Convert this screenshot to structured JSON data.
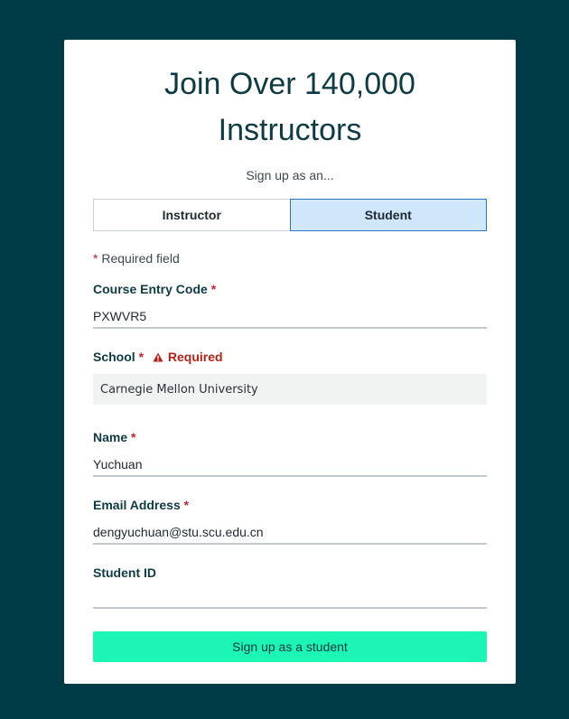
{
  "header": {
    "title_line1": "Join Over 140,000",
    "title_line2": "Instructors",
    "subtitle": "Sign up as an..."
  },
  "role_toggle": {
    "options": [
      "Instructor",
      "Student"
    ],
    "selected": "Student"
  },
  "required_note": {
    "star": "*",
    "text": "Required field"
  },
  "fields": {
    "course_entry_code": {
      "label": "Course Entry Code",
      "required_star": "*",
      "value": "PXWVR5"
    },
    "school": {
      "label": "School",
      "required_star": "*",
      "error": "Required",
      "value": "Carnegie Mellon University"
    },
    "name": {
      "label": "Name",
      "required_star": "*",
      "value": "Yuchuan"
    },
    "email": {
      "label": "Email Address",
      "required_star": "*",
      "value": "dengyuchuan@stu.scu.edu.cn"
    },
    "student_id": {
      "label": "Student ID",
      "value": ""
    }
  },
  "submit": {
    "label": "Sign up as a student"
  },
  "colors": {
    "background": "#003b48",
    "accent_button": "#1cf5b4",
    "selected_toggle": "#cfe7fb",
    "error": "#b42318"
  },
  "icons": {
    "error_icon": "warning-triangle-icon"
  }
}
